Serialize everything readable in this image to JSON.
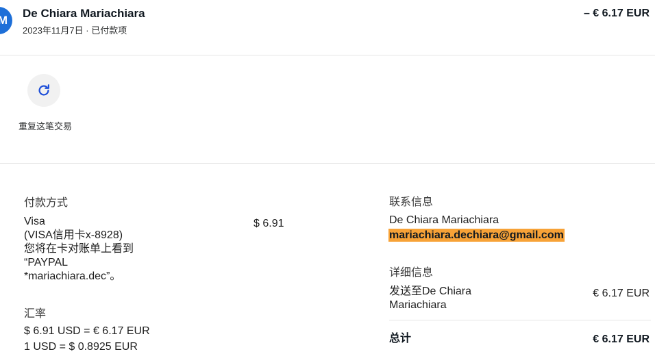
{
  "header": {
    "avatar_initial": "M",
    "name": "De Chiara Mariachiara",
    "subtitle": "2023年11月7日 · 已付款项",
    "amount": "– € 6.17 EUR"
  },
  "actions": {
    "repeat_icon": "refresh-icon",
    "repeat_label": "重复这笔交易"
  },
  "payment": {
    "section_title": "付款方式",
    "method_lines": [
      "Visa",
      "(VISA信用卡x-8928)",
      "您将在卡对账单上看到",
      "“PAYPAL",
      "*mariachiara.dec”。"
    ],
    "method_amount": "$ 6.91"
  },
  "exchange": {
    "section_title": "汇率",
    "line1": "$ 6.91 USD = € 6.17 EUR",
    "line2": "1 USD = $ 0.8925 EUR"
  },
  "contact": {
    "section_title": "联系信息",
    "name": "De Chiara Mariachiara",
    "email": "mariachiara.dechiara@gmail.com"
  },
  "details": {
    "section_title": "详细信息",
    "sent_to_line1": "发送至De Chiara",
    "sent_to_line2": "Mariachiara",
    "sent_amount": "€ 6.17 EUR",
    "total_label": "总计",
    "total_amount": "€ 6.17 EUR"
  },
  "colors": {
    "avatar": "#1d6fd8",
    "email_highlight": "#f7a237",
    "icon": "#1d4ed8"
  }
}
